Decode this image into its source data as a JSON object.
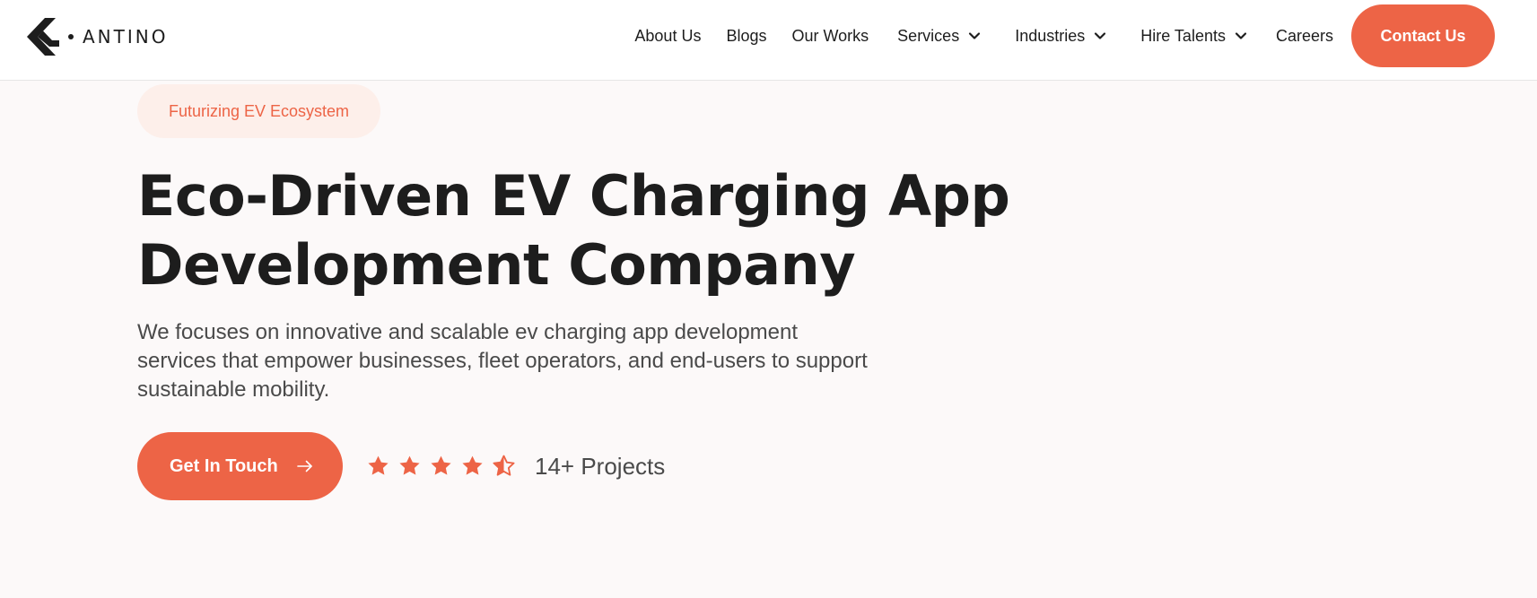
{
  "brand": {
    "name": "ANTINO",
    "logo_icon": "antino-chevron-logo",
    "accent_color": "#ed6446"
  },
  "nav": {
    "items": [
      {
        "label": "About Us",
        "dropdown": false
      },
      {
        "label": "Blogs",
        "dropdown": false
      },
      {
        "label": "Our Works",
        "dropdown": false
      },
      {
        "label": "Services",
        "dropdown": true
      },
      {
        "label": "Industries",
        "dropdown": true
      },
      {
        "label": "Hire Talents",
        "dropdown": true
      },
      {
        "label": "Careers",
        "dropdown": false
      }
    ],
    "contact_label": "Contact Us",
    "dropdown_icon": "chevron-down-icon"
  },
  "hero": {
    "tag": "Futurizing EV Ecosystem",
    "headline_line1": "Eco-Driven EV Charging App",
    "headline_line2": "Development Company",
    "description": "We focuses on innovative and scalable ev charging app development services that empower businesses, fleet operators, and end-users to support sustainable mobility.",
    "cta_label": "Get In Touch",
    "cta_icon": "arrow-right-icon",
    "rating": {
      "value": 4.5,
      "max": 5,
      "icon": "star-icon"
    },
    "projects_label": "14+ Projects"
  }
}
